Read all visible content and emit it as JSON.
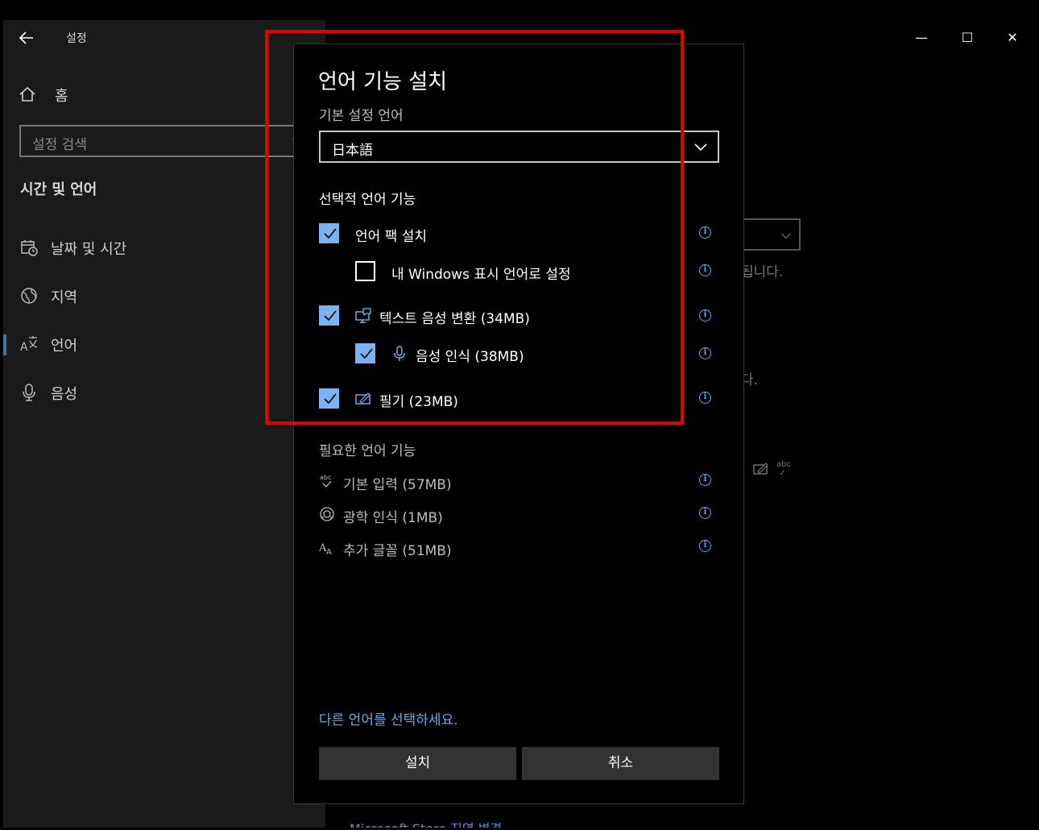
{
  "window": {
    "title": "설정",
    "controls": {
      "minimize": "—",
      "maximize": "☐",
      "close": "✕"
    }
  },
  "sidebar": {
    "home_label": "홈",
    "search_placeholder": "설정 검색",
    "section_heading": "시간 및 언어",
    "items": [
      {
        "label": "날짜 및 시간",
        "icon": "calendar-clock-icon"
      },
      {
        "label": "지역",
        "icon": "globe-icon"
      },
      {
        "label": "언어",
        "icon": "language-icon",
        "active": true
      },
      {
        "label": "음성",
        "icon": "microphone-icon"
      }
    ]
  },
  "background": {
    "partial_text_1": "됩니다.",
    "partial_text_2": "다.",
    "store_link": "Microsoft Store 지역 변경"
  },
  "dialog": {
    "title": "언어 기능 설치",
    "preferred_label": "기본 설정 언어",
    "preferred_value": "日本語",
    "optional_heading": "선택적 언어 기능",
    "options": [
      {
        "label": "언어 팩 설치",
        "checked": true
      },
      {
        "label": "내 Windows 표시 언어로 설정",
        "checked": false
      },
      {
        "label": "텍스트 음성 변환 (34MB)",
        "checked": true,
        "icon": "text-to-speech-icon"
      },
      {
        "label": "음성 인식 (38MB)",
        "checked": true,
        "icon": "microphone-icon"
      },
      {
        "label": "필기 (23MB)",
        "checked": true,
        "icon": "handwriting-icon"
      }
    ],
    "required_heading": "필요한 언어 기능",
    "required": [
      {
        "label": "기본 입력 (57MB)",
        "icon": "abc-check-icon"
      },
      {
        "label": "광학 인식 (1MB)",
        "icon": "ocr-icon"
      },
      {
        "label": "추가 글꼴 (51MB)",
        "icon": "fonts-icon"
      }
    ],
    "choose_other_link": "다른 언어를 선택하세요.",
    "install_button": "설치",
    "cancel_button": "취소"
  }
}
